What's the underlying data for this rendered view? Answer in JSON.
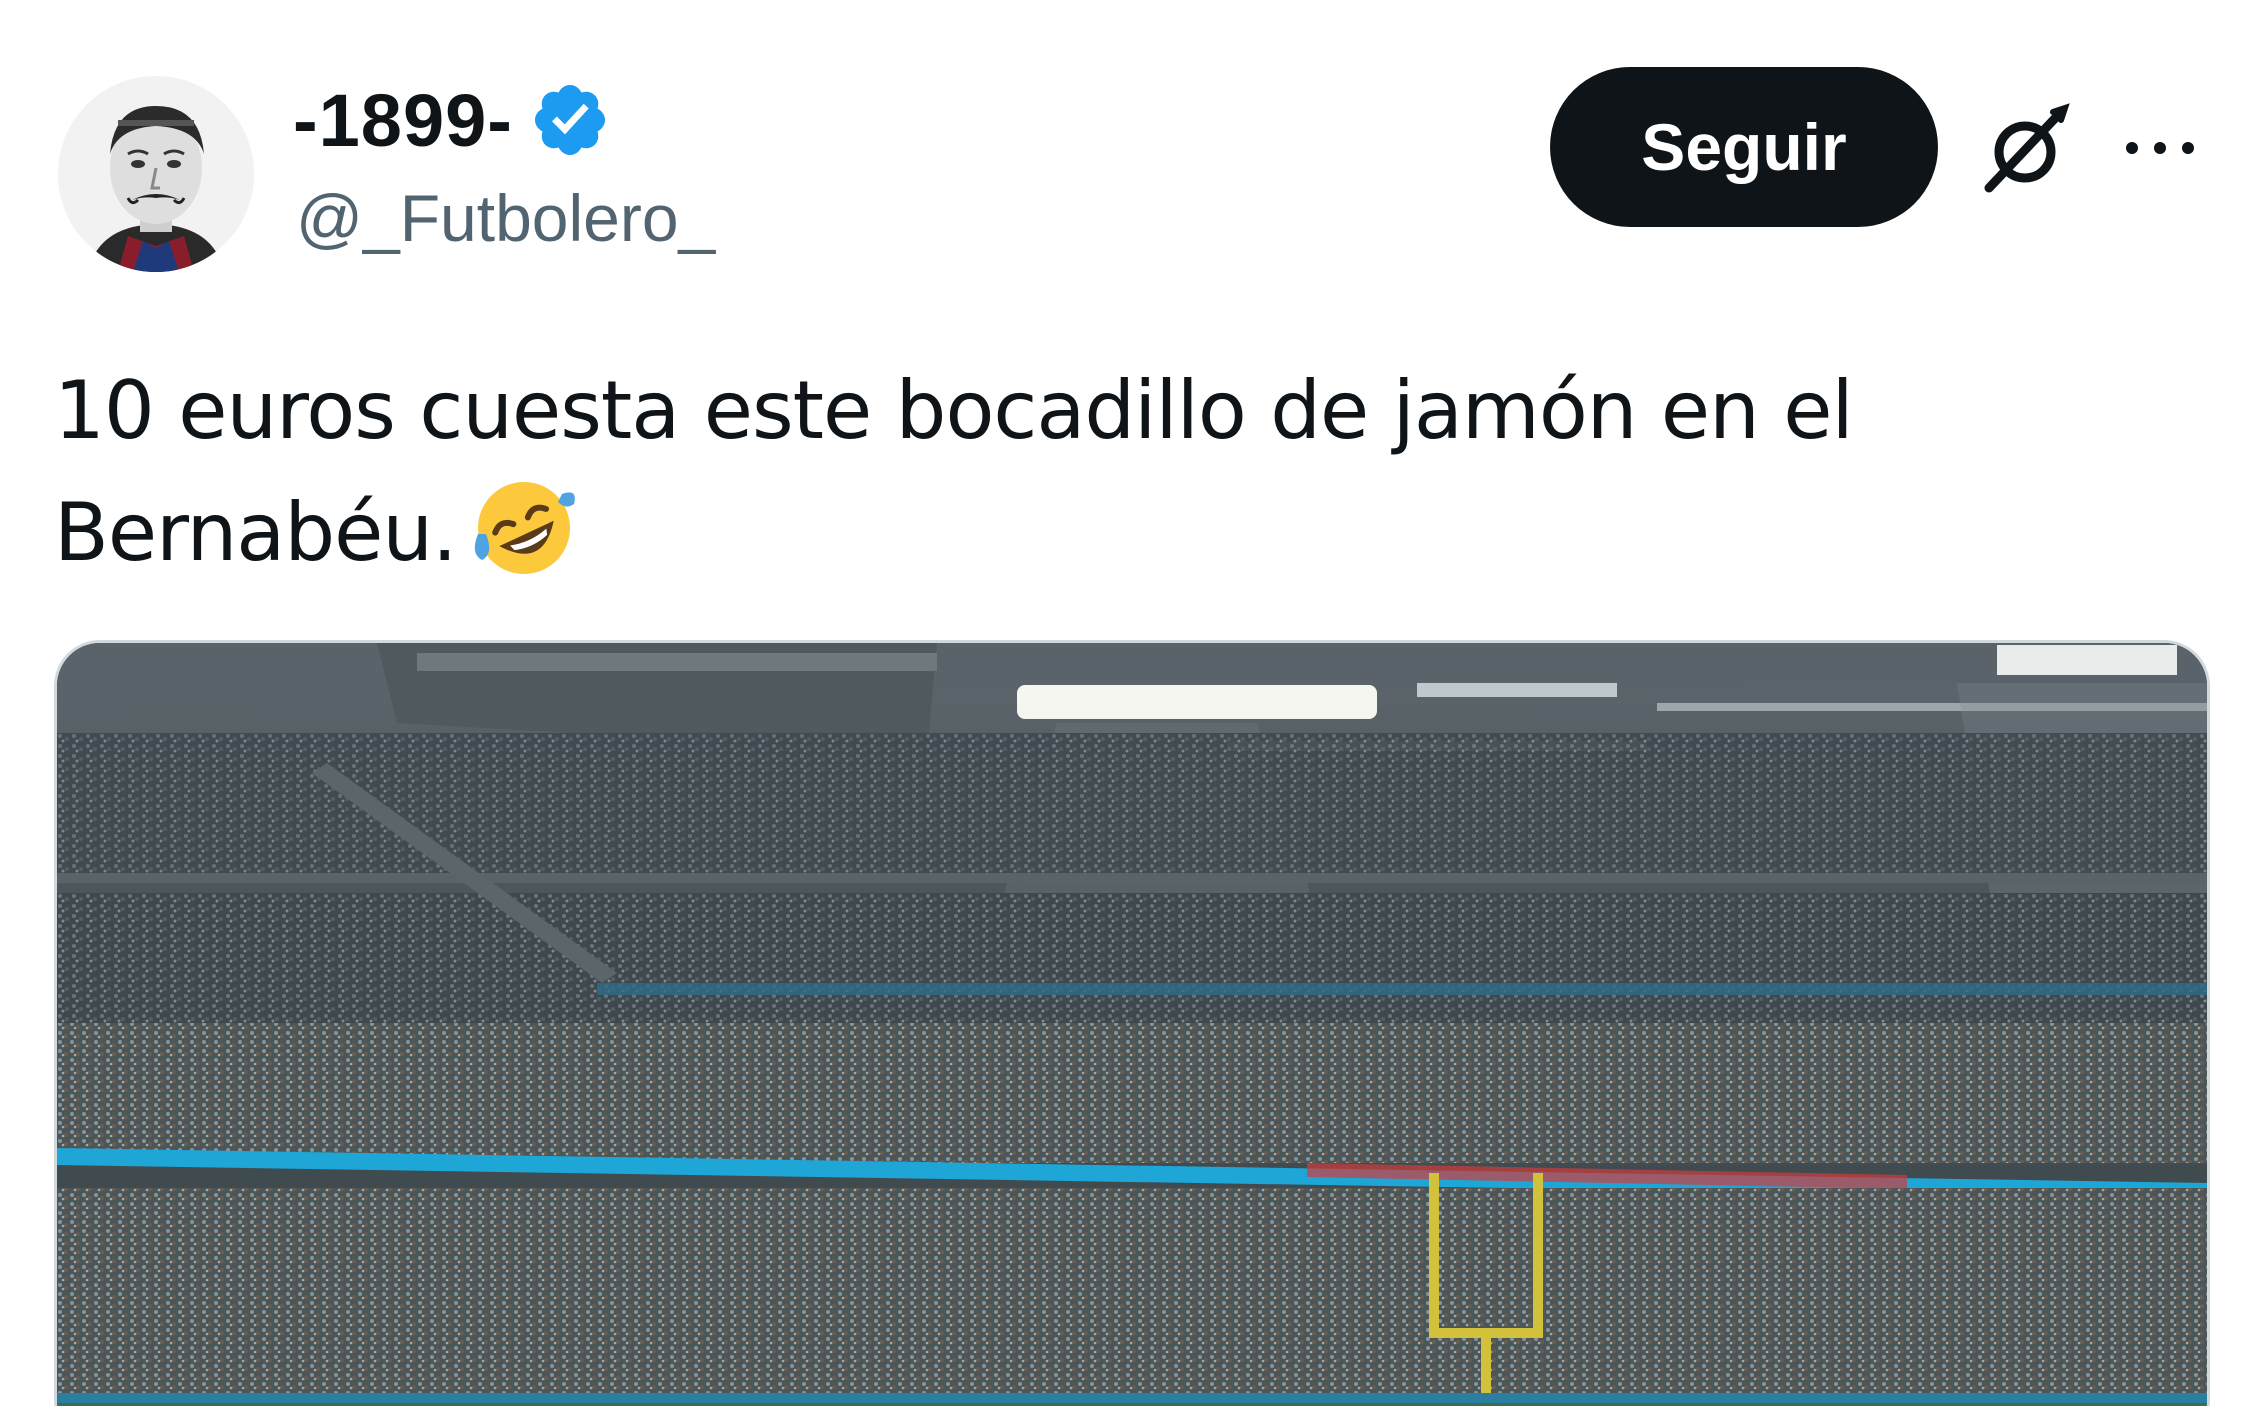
{
  "author": {
    "display_name": "-1899-",
    "handle": "@_Futbolero_",
    "verified": true,
    "avatar": "vintage-portrait-avatar"
  },
  "actions": {
    "follow_label": "Seguir",
    "grok_icon": "grok-icon",
    "more_icon": "more-options-icon"
  },
  "tweet": {
    "text_line_1": "10 euros cuesta este bocadillo de jamón en el",
    "text_line_2": "Bernabéu.",
    "emoji": "rolling-on-floor-laughing"
  },
  "media": {
    "description_icon": "stadium-photo"
  },
  "colors": {
    "text_primary": "#0f1419",
    "text_secondary": "#536471",
    "verified_blue": "#1d9bf0",
    "button_bg": "#0f1419",
    "border": "#cfd9de"
  }
}
